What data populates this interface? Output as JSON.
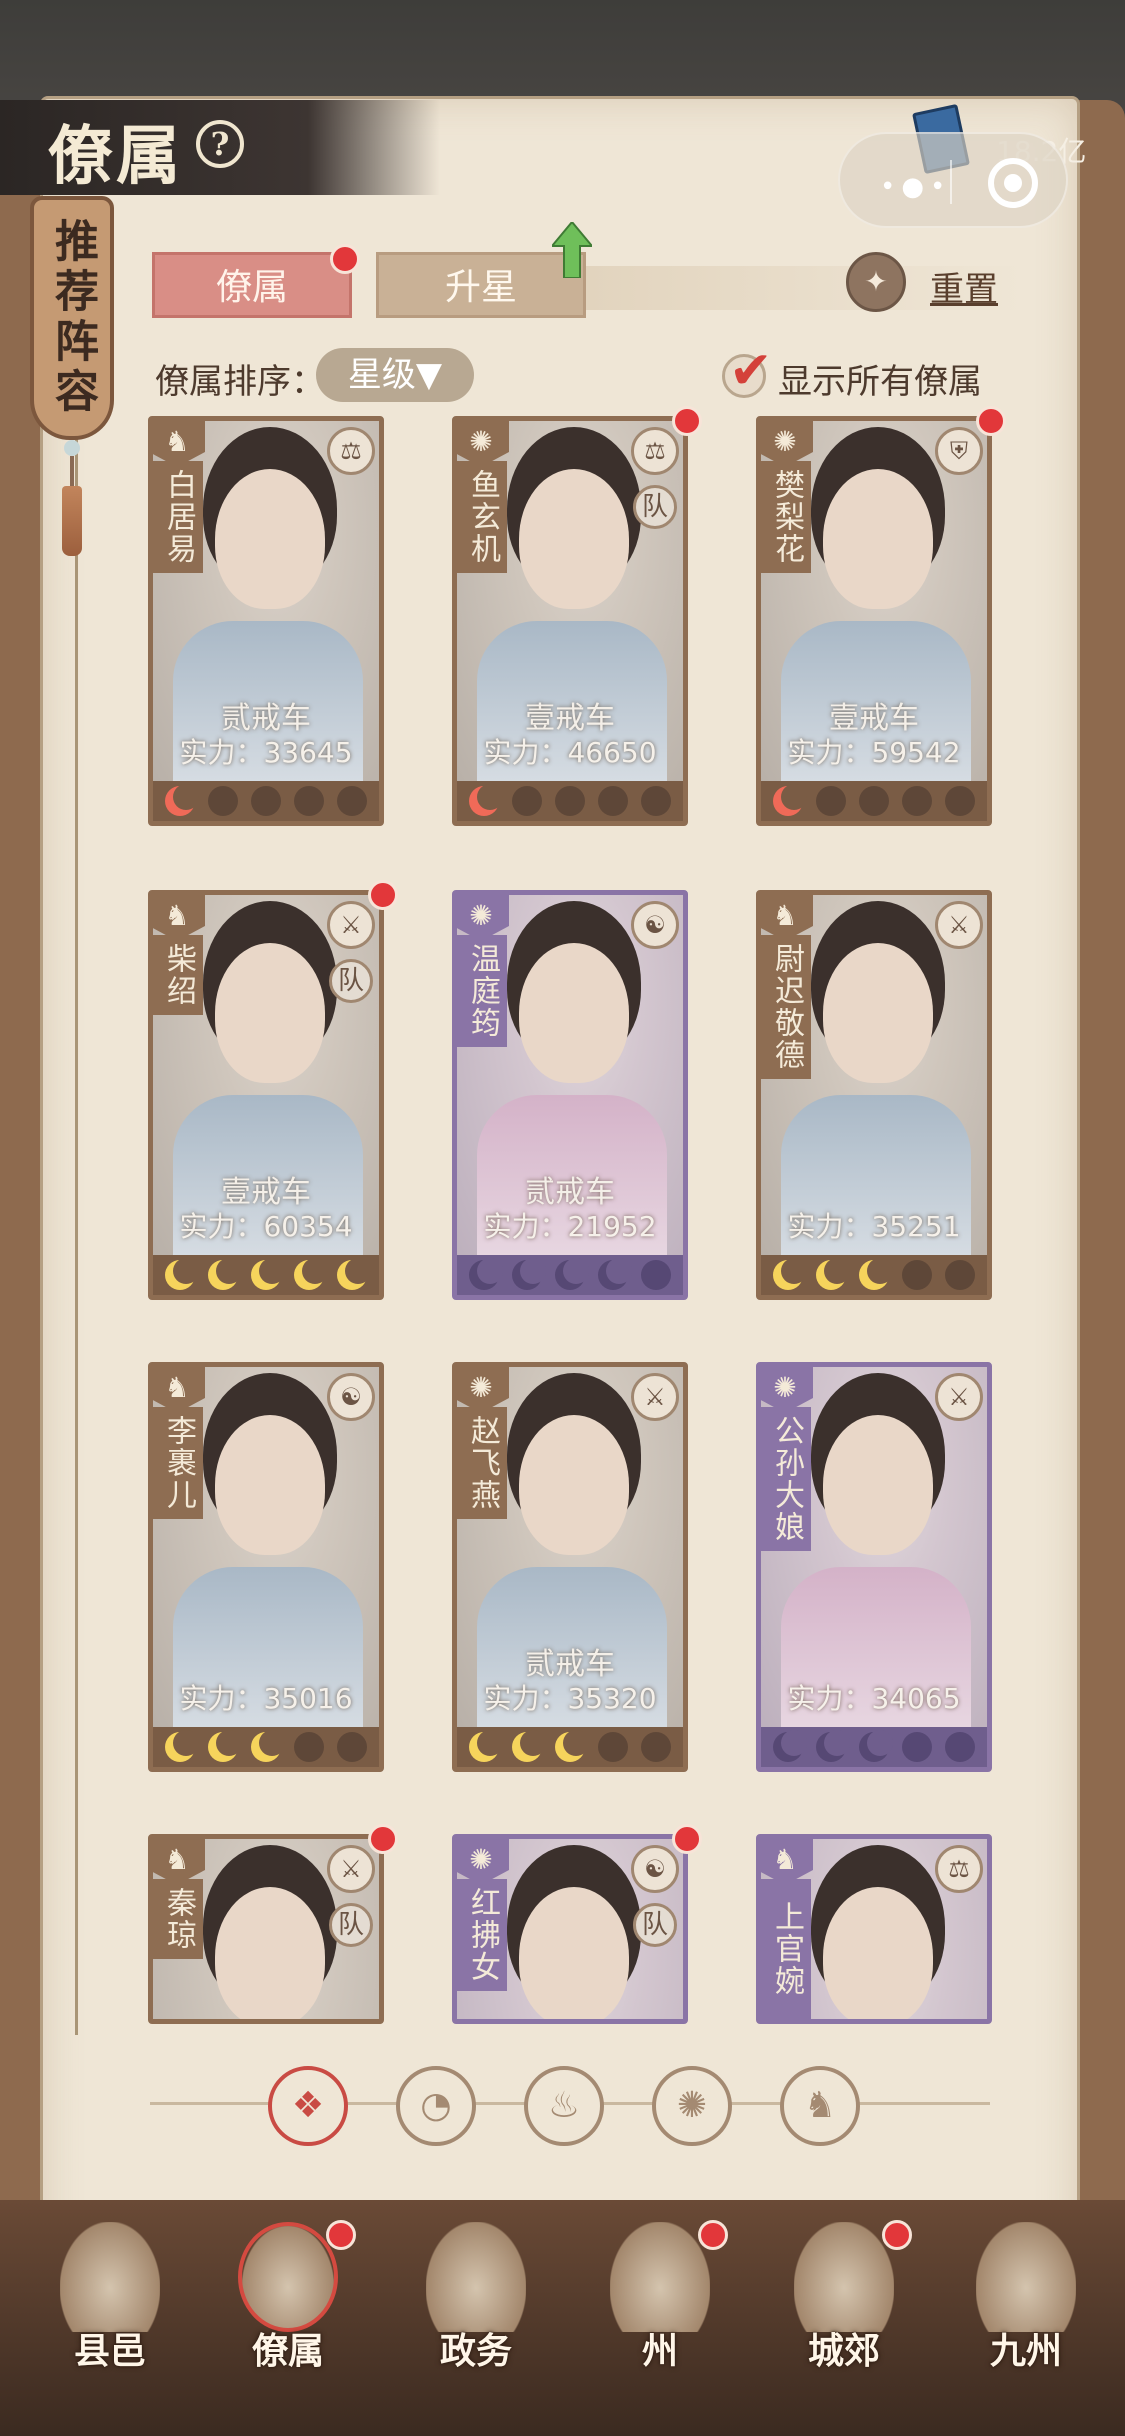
{
  "title": "僚属",
  "recommend_banner": "推荐阵容",
  "currency": "18.2亿",
  "tabs": [
    {
      "label": "僚属",
      "active": true
    },
    {
      "label": "升星",
      "active": false
    }
  ],
  "reset_label": "重置",
  "sort": {
    "label": "僚属排序：",
    "value": "星级▼"
  },
  "show_all": {
    "label": "显示所有僚属",
    "checked": true
  },
  "cards": [
    {
      "name": "白居易",
      "rank": "贰戒车",
      "power": "实力：33645",
      "stars": 1,
      "star_color": "red",
      "frame": "brown",
      "team": false,
      "red_dot": false
    },
    {
      "name": "鱼玄机",
      "rank": "壹戒车",
      "power": "实力：46650",
      "stars": 1,
      "star_color": "red",
      "frame": "brown",
      "team": true,
      "red_dot": true
    },
    {
      "name": "樊梨花",
      "rank": "壹戒车",
      "power": "实力：59542",
      "stars": 1,
      "star_color": "red",
      "frame": "brown",
      "team": false,
      "red_dot": true
    },
    {
      "name": "柴绍",
      "rank": "壹戒车",
      "power": "实力：60354",
      "stars": 5,
      "star_color": "gold",
      "frame": "brown",
      "team": true,
      "red_dot": true
    },
    {
      "name": "温庭筠",
      "rank": "贰戒车",
      "power": "实力：21952",
      "stars": 4,
      "star_color": "gold",
      "frame": "purple",
      "team": false,
      "red_dot": false
    },
    {
      "name": "尉迟敬德",
      "rank": "",
      "power": "实力：35251",
      "stars": 3,
      "star_color": "gold",
      "frame": "brown",
      "team": false,
      "red_dot": false
    },
    {
      "name": "李裹儿",
      "rank": "",
      "power": "实力：35016",
      "stars": 3,
      "star_color": "gold",
      "frame": "brown",
      "team": false,
      "red_dot": false
    },
    {
      "name": "赵飞燕",
      "rank": "贰戒车",
      "power": "实力：35320",
      "stars": 3,
      "star_color": "gold",
      "frame": "brown",
      "team": false,
      "red_dot": false
    },
    {
      "name": "公孙大娘",
      "rank": "",
      "power": "实力：34065",
      "stars": 3,
      "star_color": "gold",
      "frame": "purple",
      "team": false,
      "red_dot": false
    },
    {
      "name": "秦琼",
      "rank": "",
      "power": "",
      "stars": 0,
      "star_color": "gold",
      "frame": "brown",
      "team": true,
      "red_dot": true
    },
    {
      "name": "红拂女",
      "rank": "",
      "power": "",
      "stars": 0,
      "star_color": "gold",
      "frame": "purple",
      "team": true,
      "red_dot": true
    },
    {
      "name": "上官婉儿",
      "rank": "",
      "power": "",
      "stars": 0,
      "star_color": "gold",
      "frame": "purple",
      "team": false,
      "red_dot": false
    }
  ],
  "team_badge": "队",
  "bottom_nav": [
    {
      "label": "县邑",
      "active": false,
      "red_dot": false
    },
    {
      "label": "僚属",
      "active": true,
      "red_dot": true
    },
    {
      "label": "政务",
      "active": false,
      "red_dot": false
    },
    {
      "label": "州",
      "active": false,
      "red_dot": true
    },
    {
      "label": "城郊",
      "active": false,
      "red_dot": true
    },
    {
      "label": "九州",
      "active": false,
      "red_dot": false
    }
  ],
  "colors": {
    "accent_red": "#e2373a",
    "tab_active": "#d98e86",
    "frame_brown": "#8e6d52",
    "frame_purple": "#8a74a6",
    "star_gold": "#f6d45c"
  }
}
